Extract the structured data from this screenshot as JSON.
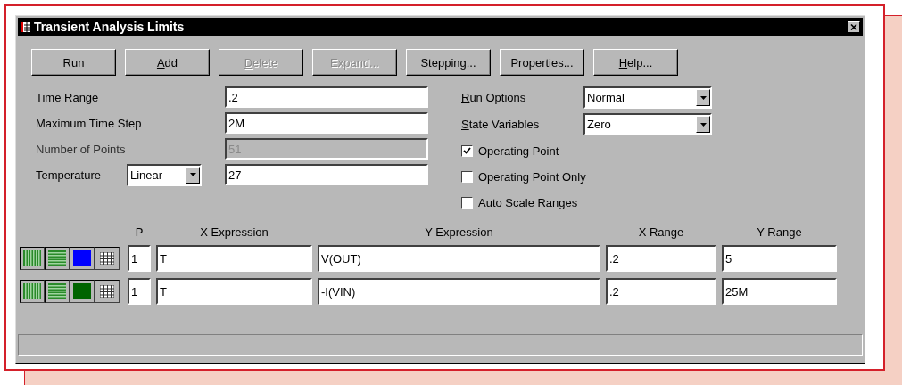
{
  "window": {
    "title": "Transient Analysis Limits"
  },
  "buttons": [
    {
      "label": "Run",
      "disabled": false,
      "mnemonic": false
    },
    {
      "label": "Add",
      "disabled": false,
      "mnemonic": true
    },
    {
      "label": "Delete",
      "disabled": true,
      "mnemonic": true
    },
    {
      "label": "Expand...",
      "disabled": true,
      "mnemonic": false
    },
    {
      "label": "Stepping...",
      "disabled": false,
      "mnemonic": false
    },
    {
      "label": "Properties...",
      "disabled": false,
      "mnemonic": false
    },
    {
      "label": "Help...",
      "disabled": false,
      "mnemonic": true
    }
  ],
  "fields": [
    {
      "label": "Time Range",
      "value": ".2",
      "disabled": false
    },
    {
      "label": "Maximum Time Step",
      "value": "2M",
      "disabled": false
    },
    {
      "label": "Number of Points",
      "value": "51",
      "disabled": true
    }
  ],
  "temperature": {
    "label": "Temperature",
    "mode": "Linear",
    "value": "27"
  },
  "dropdowns": [
    {
      "label": "Run Options",
      "value": "Normal",
      "mnemonic": true
    },
    {
      "label": "State Variables",
      "value": "Zero",
      "mnemonic": true
    }
  ],
  "checkboxes": [
    {
      "label": "Operating Point",
      "checked": true
    },
    {
      "label": "Operating Point Only",
      "checked": false
    },
    {
      "label": "Auto Scale Ranges",
      "checked": false
    }
  ],
  "table": {
    "columns": [
      "P",
      "X Expression",
      "Y Expression",
      "X Range",
      "Y Range"
    ],
    "rows": [
      {
        "color": "#0000ff",
        "p": "1",
        "x_expression": "T",
        "y_expression": "V(OUT)",
        "x_range": ".2",
        "y_range": "5"
      },
      {
        "color": "#006400",
        "p": "1",
        "x_expression": "T",
        "y_expression": "-I(VIN)",
        "x_range": ".2",
        "y_range": "25M"
      }
    ]
  }
}
